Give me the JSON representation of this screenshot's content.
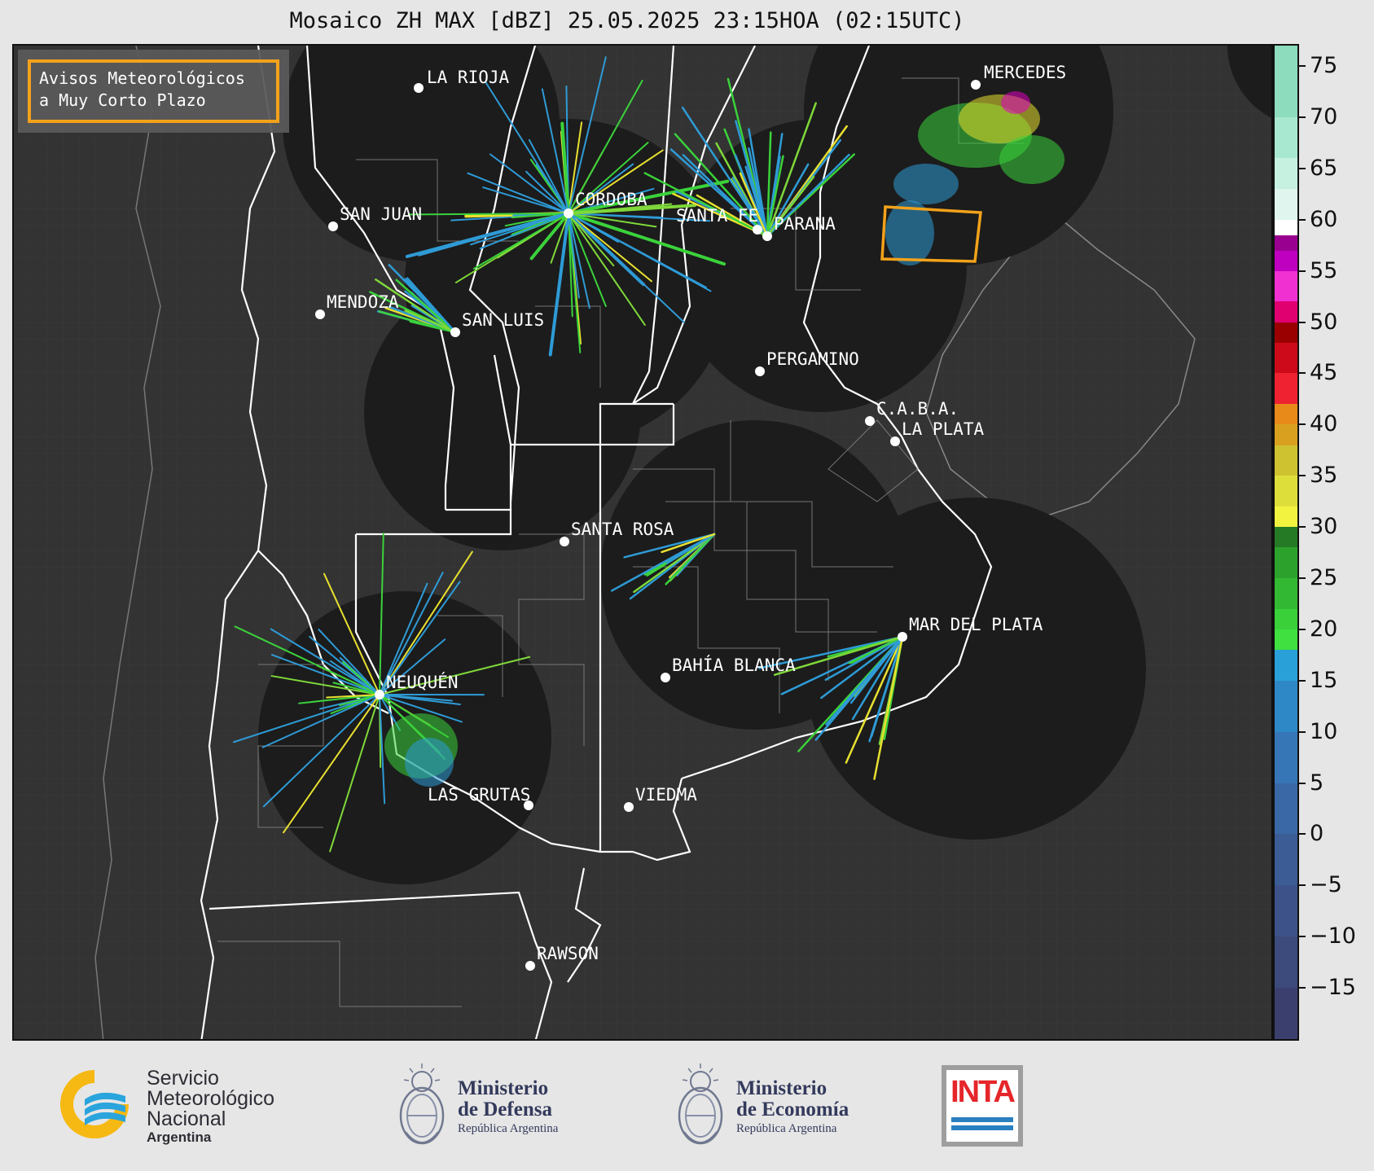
{
  "title": "Mosaico ZH MAX [dBZ] 25.05.2025 23:15HOA (02:15UTC)",
  "warning_box": {
    "line1": "Avisos Meteorológicos",
    "line2": "a Muy Corto Plazo",
    "border_color": "#f3a21a"
  },
  "cities": [
    {
      "name": "LA RIOJA"
    },
    {
      "name": "MERCEDES"
    },
    {
      "name": "CORDOBA"
    },
    {
      "name": "SAN JUAN"
    },
    {
      "name": "SANTA FE"
    },
    {
      "name": "PARANA"
    },
    {
      "name": "MENDOZA"
    },
    {
      "name": "SAN LUIS"
    },
    {
      "name": "PERGAMINO"
    },
    {
      "name": "C.A.B.A."
    },
    {
      "name": "LA PLATA"
    },
    {
      "name": "SANTA ROSA"
    },
    {
      "name": "MAR DEL PLATA"
    },
    {
      "name": "NEUQUÉN"
    },
    {
      "name": "BAHÍA BLANCA"
    },
    {
      "name": "LAS GRUTAS"
    },
    {
      "name": "VIEDMA"
    },
    {
      "name": "RAWSON"
    }
  ],
  "colorbar": {
    "unit": "dBZ",
    "ticks": [
      "75",
      "70",
      "65",
      "60",
      "55",
      "50",
      "45",
      "40",
      "35",
      "30",
      "25",
      "20",
      "15",
      "10",
      "5",
      "0",
      "−5",
      "−10",
      "−15"
    ],
    "min": -20,
    "max": 77
  },
  "footer": {
    "smn_line1": "Servicio",
    "smn_line2": "Meteorológico",
    "smn_line3": "Nacional",
    "smn_line4": "Argentina",
    "defensa_line1": "Ministerio",
    "defensa_line2": "de Defensa",
    "defensa_line3": "República Argentina",
    "economia_line1": "Ministerio",
    "economia_line2": "de Economía",
    "economia_line3": "República Argentina",
    "inta": "INTA"
  },
  "colors": {
    "map_background": "#333333",
    "radar_disc": "#1c1c1c",
    "border_white": "#ffffff",
    "smn_blue": "#2aa4dc",
    "smn_yellow": "#f6b812",
    "inta_red": "#e5262a"
  }
}
